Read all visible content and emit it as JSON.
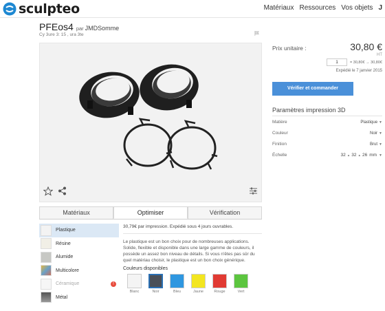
{
  "header": {
    "brand": "sculpteo",
    "nav": [
      "Matériaux",
      "Ressources",
      "Vos objets",
      "J"
    ]
  },
  "product": {
    "name": "PFEos4",
    "by": "par",
    "author": "JMDSomme",
    "subtitle": "Cy 3ure 3: 15 , ura 3te"
  },
  "tabs": [
    "Matériaux",
    "Optimiser",
    "Vérification"
  ],
  "materials": [
    {
      "label": "Plastique",
      "color": "#f3f3f3",
      "active": true
    },
    {
      "label": "Résine",
      "color": "#f1efe6"
    },
    {
      "label": "Alumide",
      "color": "#c7c8c4"
    },
    {
      "label": "Multicolore",
      "color": "#d9c98f"
    },
    {
      "label": "Céramique",
      "color": "#f6f6f6",
      "disabled": true,
      "alert": "!"
    },
    {
      "label": "Métal",
      "color": "#7d7d7d"
    }
  ],
  "detail": {
    "top": "30,79€ par impression. Expédié sous 4 jours ouvrables.",
    "description": "Le plastique est un bon choix pour de nombreuses applications. Solide, flexible et disponible dans une large gamme de couleurs, il possède un assez bon niveau de détails. Si vous n'êtes pas sûr du quel matériau choisir, le plastique est un bon choix générique.",
    "colors_label": "Couleurs disponibles",
    "colors": [
      {
        "name": "Blanc",
        "hex": "#f4f4f4"
      },
      {
        "name": "Noir",
        "hex": "#4a4f57"
      },
      {
        "name": "Bleu",
        "hex": "#2f97e0"
      },
      {
        "name": "Jaune",
        "hex": "#f3e620"
      },
      {
        "name": "Rouge",
        "hex": "#e13a33"
      },
      {
        "name": "Vert",
        "hex": "#5cc53f"
      }
    ]
  },
  "order": {
    "price_label": "Prix unitaire :",
    "price": "30,80 €",
    "price_ht": "HT",
    "qty": "1",
    "range": "= 30,80€ → 30,80€",
    "shipping": "Expédié le 7 janvier 2015",
    "button": "Vérifier et commander",
    "params_title": "Paramètres impression 3D",
    "params": [
      {
        "label": "Matière",
        "value": "Plastique"
      },
      {
        "label": "Couleur",
        "value": "Noir"
      },
      {
        "label": "Finition",
        "value": "Brut"
      }
    ],
    "scale_label": "Échelle",
    "scale_x": "32",
    "scale_y": "32",
    "scale_z": "26",
    "unit": "mm"
  },
  "colors": {
    "accent": "#4a90d9",
    "brand_blue": "#1e88d2"
  }
}
